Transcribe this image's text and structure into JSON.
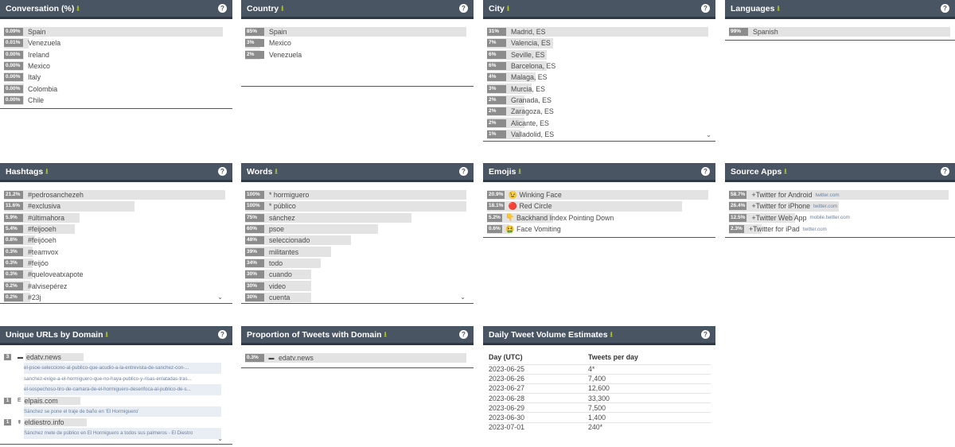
{
  "panels": {
    "conversation": {
      "title": "Conversation (%)",
      "download": "⭳",
      "help": "?",
      "rows": [
        {
          "pct": "0.09%",
          "label": "Spain",
          "fill": 0.99
        },
        {
          "pct": "0.01%",
          "label": "Venezuela",
          "fill": 0.11
        },
        {
          "pct": "0.00%",
          "label": "Ireland",
          "fill": 0.09
        },
        {
          "pct": "0.00%",
          "label": "Mexico",
          "fill": 0.09
        },
        {
          "pct": "0.00%",
          "label": "Italy",
          "fill": 0.09
        },
        {
          "pct": "0.00%",
          "label": "Colombia",
          "fill": 0.09
        },
        {
          "pct": "0.00%",
          "label": "Chile",
          "fill": 0.09
        }
      ]
    },
    "country": {
      "title": "Country",
      "download": "⭳",
      "help": "?",
      "rows": [
        {
          "pct": "85%",
          "label": "Spain",
          "fill": 1.0
        },
        {
          "pct": "3%",
          "label": "Mexico",
          "fill": 0.07
        },
        {
          "pct": "2%",
          "label": "Venezuela",
          "fill": 0.07
        }
      ]
    },
    "city": {
      "title": "City",
      "download": "⭳",
      "help": "?",
      "more": "⌄",
      "rows": [
        {
          "pct": "31%",
          "label": "Madrid, ES",
          "fill": 1.0
        },
        {
          "pct": "7%",
          "label": "Valencia, ES",
          "fill": 0.3
        },
        {
          "pct": "6%",
          "label": "Seville, ES",
          "fill": 0.27
        },
        {
          "pct": "6%",
          "label": "Barcelona, ES",
          "fill": 0.27
        },
        {
          "pct": "4%",
          "label": "Malaga, ES",
          "fill": 0.22
        },
        {
          "pct": "3%",
          "label": "Murcia, ES",
          "fill": 0.2
        },
        {
          "pct": "2%",
          "label": "Granada, ES",
          "fill": 0.17
        },
        {
          "pct": "2%",
          "label": "Zaragoza, ES",
          "fill": 0.17
        },
        {
          "pct": "2%",
          "label": "Alicante, ES",
          "fill": 0.17
        },
        {
          "pct": "1%",
          "label": "Valladolid, ES",
          "fill": 0.15
        }
      ]
    },
    "languages": {
      "title": "Languages",
      "download": "⭳",
      "help": "?",
      "rows": [
        {
          "pct": "99%",
          "label": "Spanish",
          "fill": 1.0
        }
      ]
    },
    "hashtags": {
      "title": "Hashtags",
      "download": "⭳",
      "help": "?",
      "more": "⌄",
      "rows": [
        {
          "pct": "21.2%",
          "label": "#pedrosanchezeh",
          "fill": 1.0
        },
        {
          "pct": "11.6%",
          "label": "#exclusiva",
          "fill": 0.59
        },
        {
          "pct": "5.9%",
          "label": "#últimahora",
          "fill": 0.34
        },
        {
          "pct": "5.4%",
          "label": "#feijooeh",
          "fill": 0.32
        },
        {
          "pct": "0.8%",
          "label": "#feijóoeh",
          "fill": 0.14
        },
        {
          "pct": "0.3%",
          "label": "#teamvox",
          "fill": 0.13
        },
        {
          "pct": "0.3%",
          "label": "#feijóo",
          "fill": 0.13
        },
        {
          "pct": "0.3%",
          "label": "#queloveatxapote",
          "fill": 0.13
        },
        {
          "pct": "0.2%",
          "label": "#alvisepérez",
          "fill": 0.12
        },
        {
          "pct": "0.2%",
          "label": "#23j",
          "fill": 0.12
        }
      ]
    },
    "words": {
      "title": "Words",
      "download": "⭳",
      "help": "?",
      "more": "⌄",
      "rows": [
        {
          "pct": "100%",
          "label": "* hormiguero",
          "fill": 1.0
        },
        {
          "pct": "100%",
          "label": "* público",
          "fill": 1.0
        },
        {
          "pct": "75%",
          "label": "sánchez",
          "fill": 0.75
        },
        {
          "pct": "60%",
          "label": "psoe",
          "fill": 0.6
        },
        {
          "pct": "48%",
          "label": "seleccionado",
          "fill": 0.48
        },
        {
          "pct": "39%",
          "label": "militantes",
          "fill": 0.39
        },
        {
          "pct": "34%",
          "label": "todo",
          "fill": 0.34
        },
        {
          "pct": "30%",
          "label": "cuando",
          "fill": 0.3
        },
        {
          "pct": "30%",
          "label": "video",
          "fill": 0.3
        },
        {
          "pct": "30%",
          "label": "cuenta",
          "fill": 0.3
        }
      ]
    },
    "emojis": {
      "title": "Emojis",
      "download": "⭳",
      "help": "?",
      "rows": [
        {
          "pct": "20.9%",
          "emoji": "😉",
          "emoji_name": "winking-face-icon",
          "label": "Winking Face",
          "fill": 1.0
        },
        {
          "pct": "18.1%",
          "emoji": "🔴",
          "emoji_name": "red-circle-icon",
          "label": "Red Circle",
          "fill": 0.88
        },
        {
          "pct": "5.2%",
          "emoji": "👇",
          "emoji_name": "backhand-index-icon",
          "label": "Backhand Index Pointing Down",
          "fill": 0.3
        },
        {
          "pct": "0.6%",
          "emoji": "🤮",
          "emoji_name": "face-vomiting-icon",
          "label": "Face Vomiting",
          "fill": 0.1
        }
      ]
    },
    "source_apps": {
      "title": "Source Apps",
      "download": "⭳",
      "help": "?",
      "rows": [
        {
          "pct": "58.7%",
          "label": "+Twitter for Android",
          "sub": "twitter.com",
          "fill": 1.0
        },
        {
          "pct": "26.4%",
          "label": "+Twitter for iPhone",
          "sub": "twitter.com",
          "fill": 0.5
        },
        {
          "pct": "12.5%",
          "label": "+Twitter Web App",
          "sub": "mobile.twitter.com",
          "fill": 0.3
        },
        {
          "pct": "2.3%",
          "label": "+Twitter for iPad",
          "sub": "twitter.com",
          "fill": 0.15
        }
      ]
    },
    "unique_urls": {
      "title": "Unique URLs by Domain",
      "download": "⭳",
      "help": "?",
      "more": "⌄",
      "groups": [
        {
          "count": "3",
          "favicon": "▬",
          "domain": "edatv.news",
          "urls": [
            "el-psoe-selecciono-al-publico-que-acudio-a-la-entrevista-de-sanchez-con-...",
            "sanchez-exige-a-el-hormiguero-que-no-haya-publico-y-risas-enlatadas-tras...",
            "el-sospechoso-tiro-de-camara-de-el-hormiguero-desenfoca-al-publico-de-s..."
          ]
        },
        {
          "count": "1",
          "favicon": "E",
          "domain": "elpais.com",
          "urls": [
            "Sánchez se pone el traje de baño en 'El Hormiguero'"
          ]
        },
        {
          "count": "1",
          "favicon": "☤",
          "domain": "eldiestro.info",
          "urls": [
            "Sánchez mete de público en El Hormiguero a todos sus palmeros - El Diestro"
          ]
        }
      ]
    },
    "proportion": {
      "title": "Proportion of Tweets with Domain",
      "download": "⭳",
      "help": "?",
      "rows": [
        {
          "pct": "0.3%",
          "favicon": "▬",
          "label": "edatv.news",
          "fill": 1.0
        }
      ]
    },
    "daily_volume": {
      "title": "Daily Tweet Volume Estimates",
      "download": "⭳",
      "help": "?",
      "headers": [
        "Day (UTC)",
        "Tweets per day"
      ],
      "rows": [
        [
          "2023-06-25",
          "4*"
        ],
        [
          "2023-06-26",
          "7,400"
        ],
        [
          "2023-06-27",
          "12,600"
        ],
        [
          "2023-06-28",
          "33,300"
        ],
        [
          "2023-06-29",
          "7,500"
        ],
        [
          "2023-06-30",
          "1,400"
        ],
        [
          "2023-07-01",
          "240*"
        ]
      ]
    }
  }
}
